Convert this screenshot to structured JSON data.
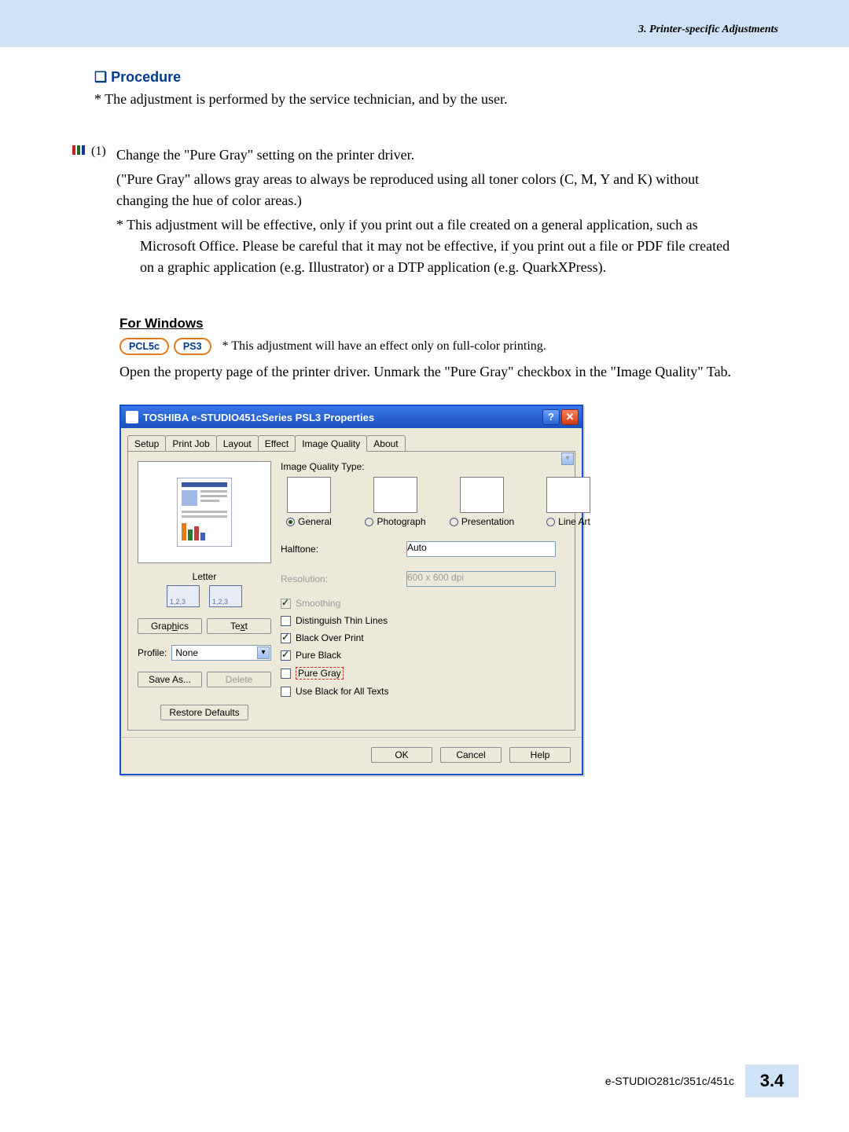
{
  "header": {
    "right": "3. Printer-specific Adjustments"
  },
  "procedure": {
    "title": "Procedure",
    "note": "* The adjustment is performed by the service technician, and by the user."
  },
  "step1": {
    "num": "(1)",
    "l1": "Change the \"Pure Gray\" setting on the printer driver.",
    "l2a": "(\"Pure Gray\" allows gray areas to always be reproduced using all toner colors (C, M, Y and K) without",
    "l2b": "changing the hue of color areas.)",
    "l3a": "* This adjustment will be effective, only if you print out a file created on a general application, such as",
    "l3b": "Microsoft Office.  Please be careful that it may not be effective, if you print out a file or PDF file created",
    "l3c": "on a graphic application (e.g. Illustrator) or a DTP application (e.g. QuarkXPress)."
  },
  "for_windows": {
    "heading": "For Windows",
    "badges": {
      "pcl": "PCL5c",
      "ps": "PS3"
    },
    "note": "* This adjustment will have an effect only on full-color printing.",
    "instr": "Open the property page of the printer driver.  Unmark the \"Pure Gray\" checkbox in the \"Image Quality\" Tab."
  },
  "dialog": {
    "title": "TOSHIBA e-STUDIO451cSeries PSL3 Properties",
    "tabs": [
      "Setup",
      "Print Job",
      "Layout",
      "Effect",
      "Image Quality",
      "About"
    ],
    "active_tab": "Image Quality",
    "left": {
      "paper": "Letter",
      "paper_sub": "1,2,3",
      "btn_graphics": "Graphics",
      "btn_text": "Text",
      "profile_lbl": "Profile:",
      "profile_val": "None",
      "btn_save": "Save As...",
      "btn_delete": "Delete",
      "btn_restore": "Restore Defaults"
    },
    "right": {
      "iqt_label": "Image Quality Type:",
      "radios": {
        "general": "General",
        "photo": "Photograph",
        "presentation": "Presentation",
        "lineart": "Line Art"
      },
      "halftone_lbl": "Halftone:",
      "halftone_val": "Auto",
      "resolution_lbl": "Resolution:",
      "resolution_val": "600 x 600 dpi",
      "smoothing": "Smoothing",
      "distinguish": "Distinguish Thin Lines",
      "blackover": "Black Over Print",
      "pureblack": "Pure Black",
      "puregray": "Pure Gray",
      "useblack": "Use Black for All Texts"
    },
    "footer": {
      "ok": "OK",
      "cancel": "Cancel",
      "help": "Help"
    }
  },
  "page_footer": {
    "model": "e-STUDIO281c/351c/451c",
    "section": "3.4"
  }
}
